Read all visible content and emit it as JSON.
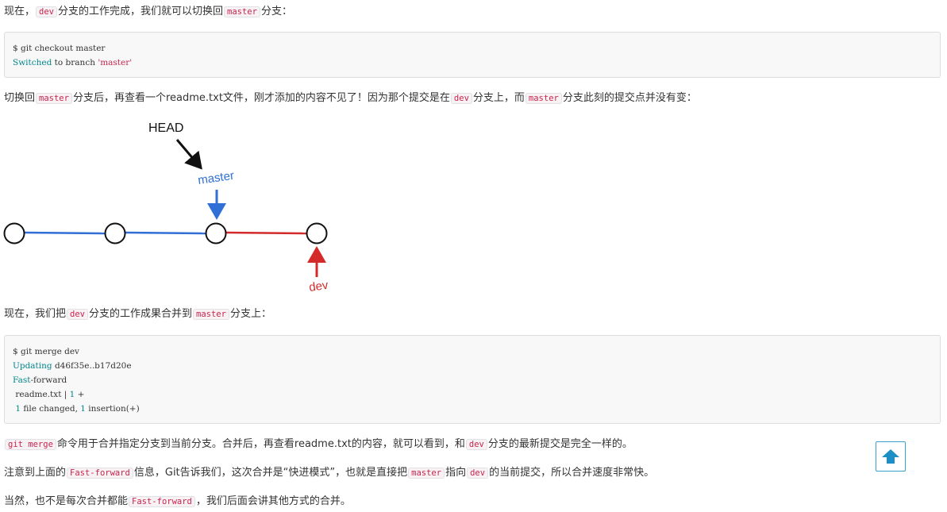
{
  "p1": {
    "t1": "现在，",
    "c1": "dev",
    "t2": "分支的工作完成，我们就可以切换回",
    "c2": "master",
    "t3": "分支："
  },
  "code1": {
    "l1": {
      "a": "$ git checkout master"
    },
    "l2": {
      "kw": "Switched",
      "b": " to branch ",
      "str": "'master'"
    }
  },
  "p2": {
    "t1": "切换回",
    "c1": "master",
    "t2": "分支后，再查看一个readme.txt文件，刚才添加的内容不见了！因为那个提交是在",
    "c2": "dev",
    "t3": "分支上，而",
    "c3": "master",
    "t4": "分支此刻的提交点并没有变："
  },
  "diagram": {
    "head_label": "HEAD",
    "master_label": "master",
    "dev_label": "dev",
    "colors": {
      "master": "#2f6fd6",
      "dev": "#d42a2a",
      "head": "#111111"
    }
  },
  "p3": {
    "t1": "现在，我们把",
    "c1": "dev",
    "t2": "分支的工作成果合并到",
    "c2": "master",
    "t3": "分支上："
  },
  "code2": {
    "l1": {
      "a": "$ git merge dev"
    },
    "l2": {
      "kw": "Updating",
      "b": " d46f35e..b17d20e"
    },
    "l3": {
      "kw": "Fast",
      "b": "-forward"
    },
    "l4": {
      "a": " readme.txt | ",
      "n": "1",
      "b": " +"
    },
    "l5": {
      "a": " ",
      "n1": "1",
      "b": " file changed, ",
      "n2": "1",
      "c": " insertion(+)"
    }
  },
  "p4": {
    "c1": "git merge",
    "t1": "命令用于合并指定分支到当前分支。合并后，再查看readme.txt的内容，就可以看到，和",
    "c2": "dev",
    "t2": "分支的最新提交是完全一样的。"
  },
  "p5": {
    "t1": "注意到上面的",
    "c1": "Fast-forward",
    "t2": "信息，Git告诉我们，这次合并是“快进模式”，也就是直接把",
    "c2": "master",
    "t3": "指向",
    "c3": "dev",
    "t4": "的当前提交，所以合并速度非常快。"
  },
  "p6": {
    "t1": "当然，也不是每次合并都能",
    "c1": "Fast-forward",
    "t2": "，我们后面会讲其他方式的合并。"
  },
  "back_to_top": {
    "icon": "arrow-up-icon",
    "color": "#1e8fc6"
  }
}
